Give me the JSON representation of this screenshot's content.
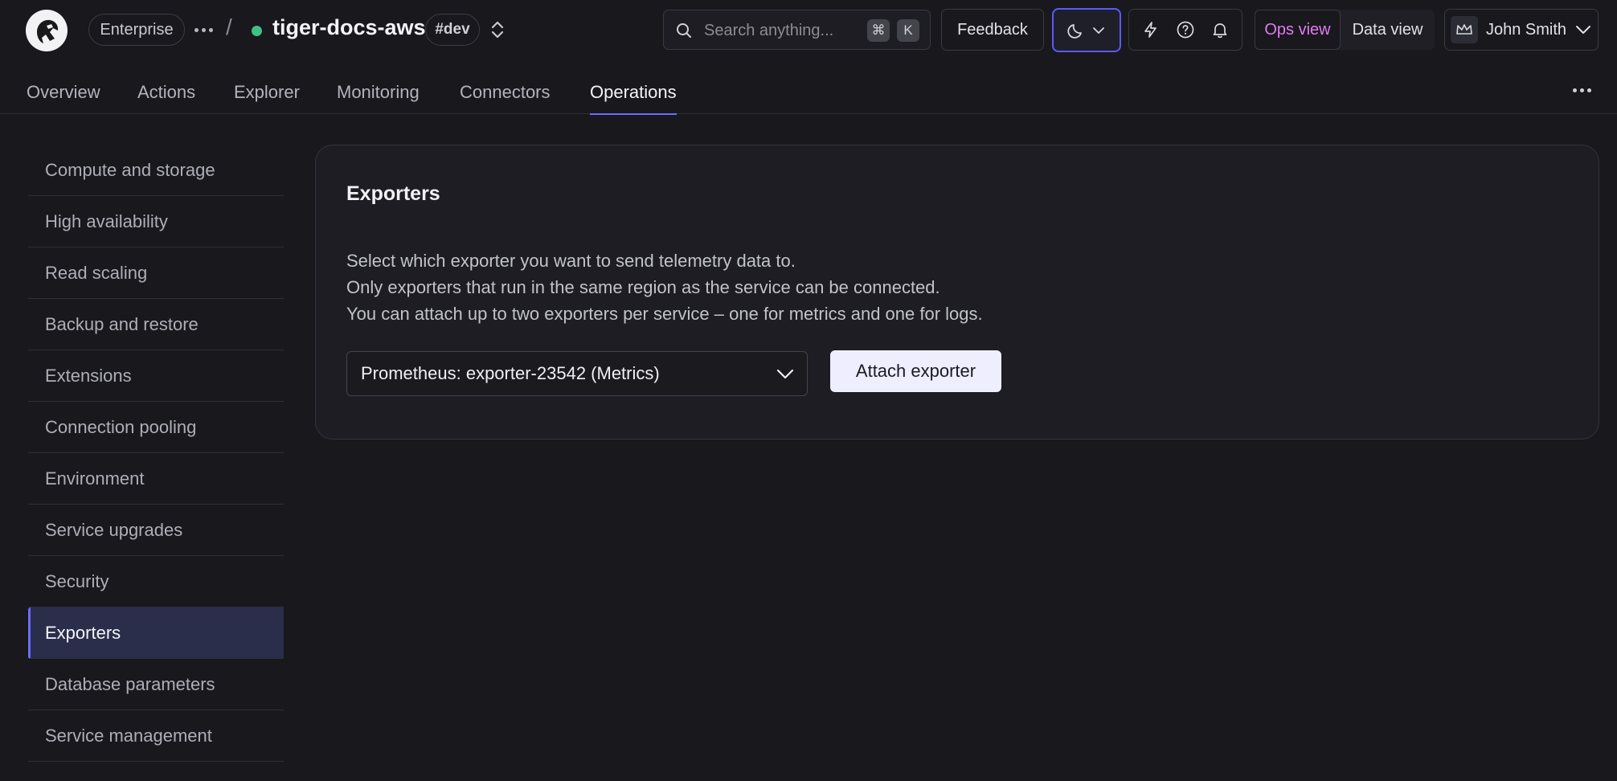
{
  "header": {
    "org_label": "Enterprise",
    "service_name": "tiger-docs-aws",
    "environment": "#dev",
    "separator": "/",
    "search": {
      "placeholder": "Search anything...",
      "shortcut_mod": "⌘",
      "shortcut_key": "K"
    },
    "feedback_label": "Feedback",
    "views": {
      "ops": "Ops view",
      "data": "Data view",
      "active": "ops"
    },
    "user_name": "John Smith"
  },
  "tabs": [
    {
      "label": "Overview",
      "active": false
    },
    {
      "label": "Actions",
      "active": false
    },
    {
      "label": "Explorer",
      "active": false
    },
    {
      "label": "Monitoring",
      "active": false
    },
    {
      "label": "Connectors",
      "active": false
    },
    {
      "label": "Operations",
      "active": true
    }
  ],
  "sidebar": {
    "items": [
      {
        "label": "Compute and storage"
      },
      {
        "label": "High availability"
      },
      {
        "label": "Read scaling"
      },
      {
        "label": "Backup and restore"
      },
      {
        "label": "Extensions"
      },
      {
        "label": "Connection pooling"
      },
      {
        "label": "Environment"
      },
      {
        "label": "Service upgrades"
      },
      {
        "label": "Security"
      },
      {
        "label": "Exporters",
        "active": true
      },
      {
        "label": "Database parameters"
      },
      {
        "label": "Service management"
      }
    ]
  },
  "panel": {
    "title": "Exporters",
    "description": [
      "Select which exporter you want to send telemetry data to.",
      "Only exporters that run in the same region as the service can be connected.",
      "You can attach up to two exporters per service – one for metrics and one for logs."
    ],
    "selected_exporter": "Prometheus: exporter-23542 (Metrics)",
    "attach_label": "Attach exporter"
  },
  "colors": {
    "background": "#18181d",
    "accent": "#6c6cff",
    "status_ok": "#3fbf87",
    "ops_view": "#e27cf2"
  }
}
